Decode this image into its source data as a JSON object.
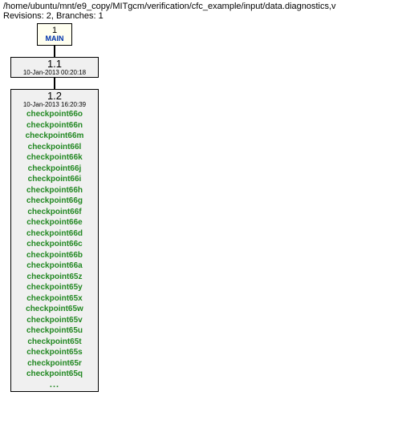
{
  "header": {
    "path": "/home/ubuntu/mnt/e9_copy/MITgcm/verification/cfc_example/input/data.diagnostics,v",
    "revline": "Revisions: 2, Branches: 1"
  },
  "branch": {
    "number": "1",
    "name": "MAIN"
  },
  "rev11": {
    "version": "1.1",
    "date": "10-Jan-2013 00:20:18"
  },
  "rev12": {
    "version": "1.2",
    "date": "10-Jan-2013 16:20:39",
    "tags": [
      "checkpoint66o",
      "checkpoint66n",
      "checkpoint66m",
      "checkpoint66l",
      "checkpoint66k",
      "checkpoint66j",
      "checkpoint66i",
      "checkpoint66h",
      "checkpoint66g",
      "checkpoint66f",
      "checkpoint66e",
      "checkpoint66d",
      "checkpoint66c",
      "checkpoint66b",
      "checkpoint66a",
      "checkpoint65z",
      "checkpoint65y",
      "checkpoint65x",
      "checkpoint65w",
      "checkpoint65v",
      "checkpoint65u",
      "checkpoint65t",
      "checkpoint65s",
      "checkpoint65r",
      "checkpoint65q"
    ],
    "ellipsis": "..."
  }
}
